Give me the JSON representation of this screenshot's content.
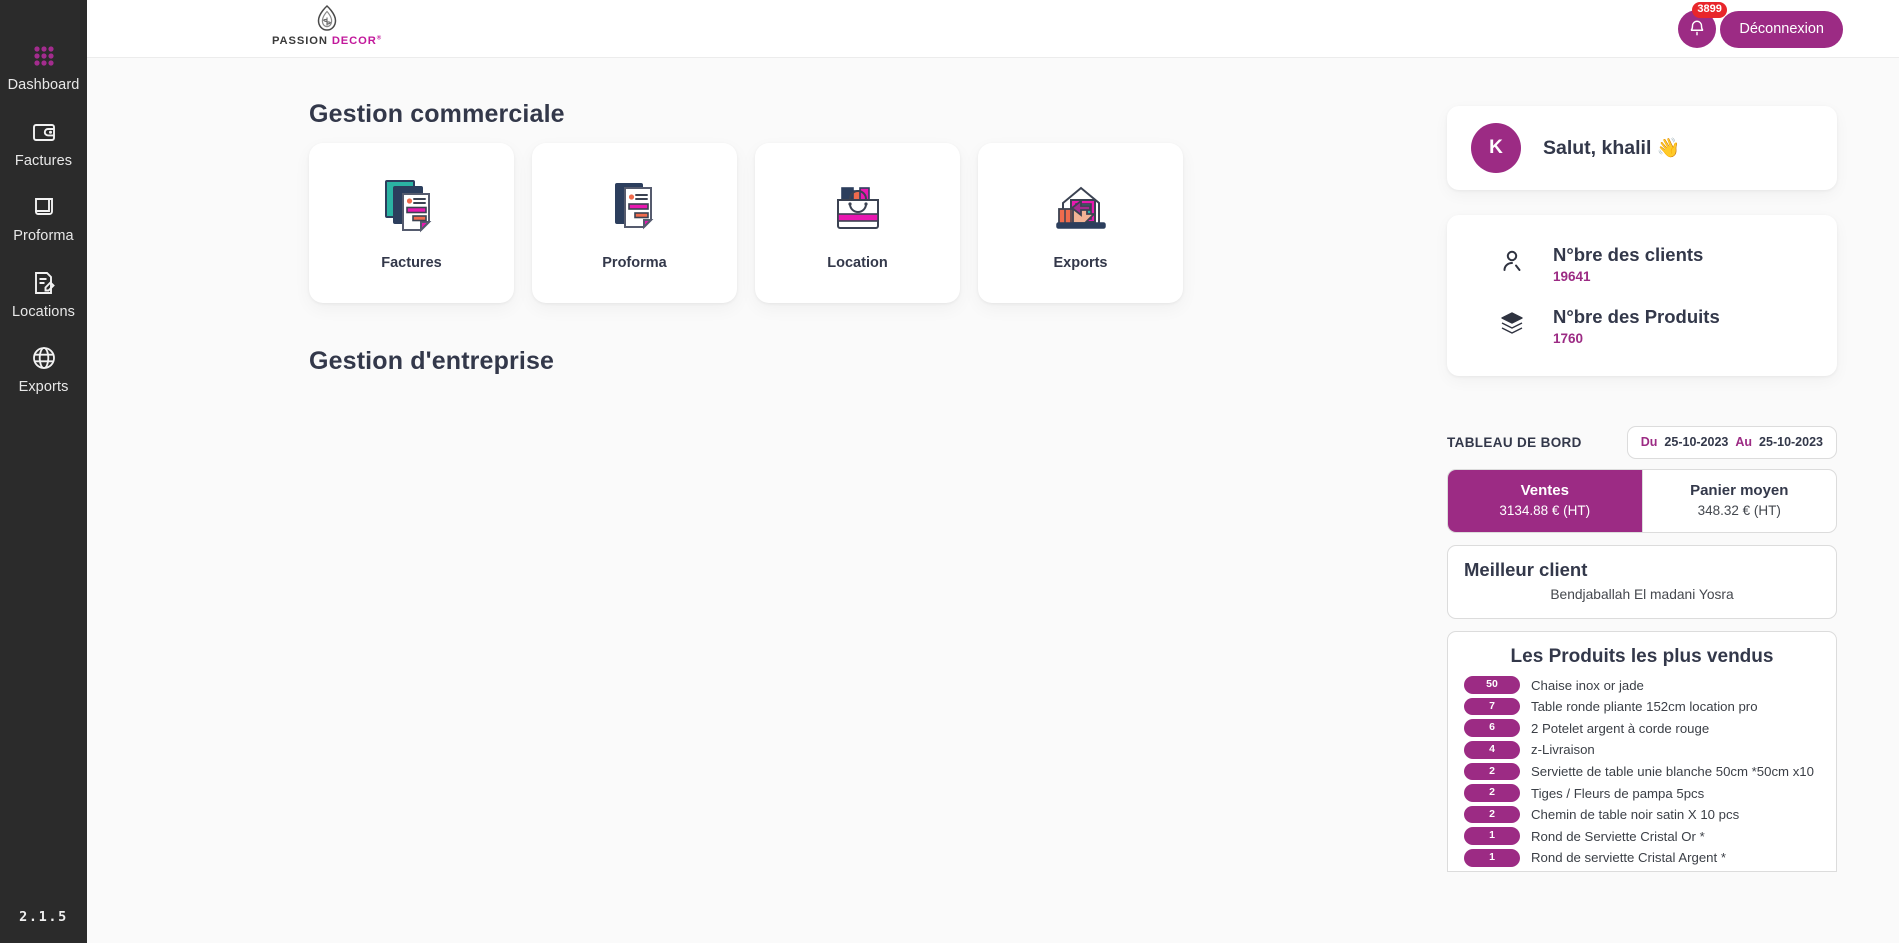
{
  "sidebar": {
    "items": [
      {
        "label": "Dashboard",
        "icon": "grid-icon",
        "active": true
      },
      {
        "label": "Factures",
        "icon": "wallet-icon",
        "active": false
      },
      {
        "label": "Proforma",
        "icon": "document-scroll-icon",
        "active": false
      },
      {
        "label": "Locations",
        "icon": "edit-document-icon",
        "active": false
      },
      {
        "label": "Exports",
        "icon": "globe-icon",
        "active": false
      }
    ],
    "version": "2.1.5"
  },
  "header": {
    "logo_primary": "PASSION",
    "logo_secondary": "DECOR",
    "logo_registered": "®",
    "notification_count": "3899",
    "logout_label": "Déconnexion"
  },
  "main": {
    "section_commercial_title": "Gestion commerciale",
    "section_entreprise_title": "Gestion d'entreprise",
    "cards": [
      {
        "label": "Factures",
        "icon": "invoice-stack-icon"
      },
      {
        "label": "Proforma",
        "icon": "proforma-document-icon"
      },
      {
        "label": "Location",
        "icon": "shopping-bag-icon"
      },
      {
        "label": "Exports",
        "icon": "warehouse-export-icon"
      }
    ]
  },
  "panel": {
    "greeting": "Salut, khalil",
    "avatar_initial": "K",
    "wave_emoji": "👋",
    "stats": [
      {
        "label": "N°bre des clients",
        "value": "19641",
        "icon": "user-icon"
      },
      {
        "label": "N°bre des Produits",
        "value": "1760",
        "icon": "layers-icon"
      }
    ],
    "dashboard_title": "TABLEAU DE BORD",
    "date_from_label": "Du",
    "date_from_value": "25-10-2023",
    "date_to_label": "Au",
    "date_to_value": "25-10-2023",
    "toggles": [
      {
        "title": "Ventes",
        "value": "3134.88 € (HT)",
        "active": true
      },
      {
        "title": "Panier moyen",
        "value": "348.32 € (HT)",
        "active": false
      }
    ],
    "best_client_title": "Meilleur client",
    "best_client_name": "Bendjaballah El madani Yosra",
    "top_products_title": "Les Produits les plus vendus",
    "top_products": [
      {
        "qty": "50",
        "name": "Chaise inox or jade"
      },
      {
        "qty": "7",
        "name": "Table ronde pliante 152cm location pro"
      },
      {
        "qty": "6",
        "name": "2 Potelet argent à corde rouge"
      },
      {
        "qty": "4",
        "name": "z-Livraison"
      },
      {
        "qty": "2",
        "name": "Serviette de table unie blanche 50cm *50cm x10"
      },
      {
        "qty": "2",
        "name": "Tiges / Fleurs de pampa 5pcs"
      },
      {
        "qty": "2",
        "name": "Chemin de table noir satin X 10 pcs"
      },
      {
        "qty": "1",
        "name": "Rond de Serviette Cristal Or *"
      },
      {
        "qty": "1",
        "name": "Rond de serviette Cristal Argent *"
      }
    ]
  },
  "colors": {
    "accent_purple": "#9c2b84",
    "logo_magenta": "#c2189b",
    "badge_red": "#e8262b",
    "sidebar_bg": "#2b2b2b",
    "text_dark": "#33384a",
    "page_bg": "#fafafa"
  }
}
